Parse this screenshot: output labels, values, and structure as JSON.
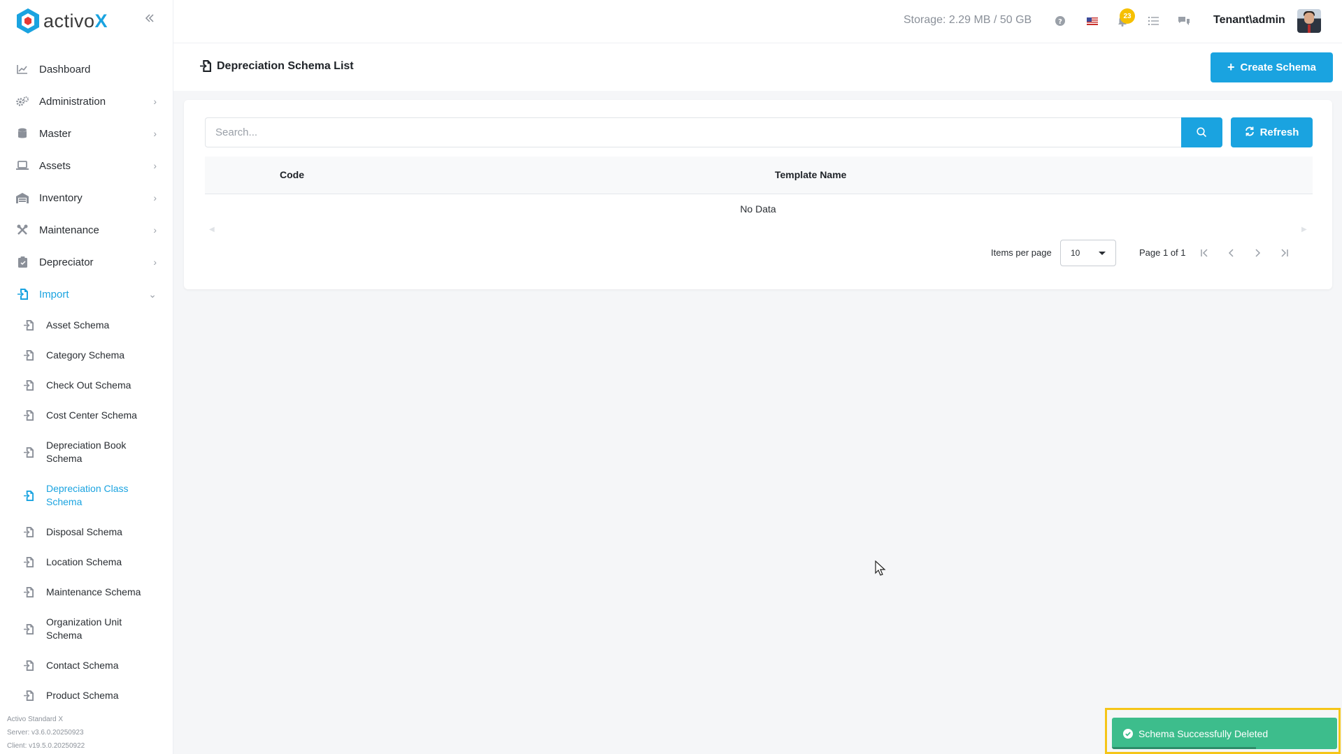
{
  "brand": {
    "name_prefix": "activo",
    "name_suffix": "X",
    "accent": "#1aa3e0"
  },
  "topbar": {
    "storage": "Storage: 2.29 MB / 50 GB",
    "notification_count": "23",
    "user": "Tenant\\admin",
    "icons": [
      "help-icon",
      "flag-us-icon",
      "bell-icon",
      "tasks-icon",
      "chat-icon"
    ]
  },
  "sidebar": {
    "items": [
      {
        "label": "Dashboard",
        "icon": "chart-line-icon"
      },
      {
        "label": "Administration",
        "icon": "cogs-icon"
      },
      {
        "label": "Master",
        "icon": "database-icon"
      },
      {
        "label": "Assets",
        "icon": "laptop-icon"
      },
      {
        "label": "Inventory",
        "icon": "warehouse-icon"
      },
      {
        "label": "Maintenance",
        "icon": "tools-icon"
      },
      {
        "label": "Depreciator",
        "icon": "clipboard-icon"
      },
      {
        "label": "Import",
        "icon": "import-icon"
      }
    ],
    "import_sub": [
      {
        "label": "Asset Schema"
      },
      {
        "label": "Category Schema"
      },
      {
        "label": "Check Out Schema"
      },
      {
        "label": "Cost Center Schema"
      },
      {
        "label": "Depreciation Book Schema"
      },
      {
        "label": "Depreciation Class Schema"
      },
      {
        "label": "Disposal Schema"
      },
      {
        "label": "Location Schema"
      },
      {
        "label": "Maintenance Schema"
      },
      {
        "label": "Organization Unit Schema"
      },
      {
        "label": "Contact Schema"
      },
      {
        "label": "Product Schema"
      }
    ],
    "footer": {
      "edition": "Activo Standard X",
      "server": "Server: v3.6.0.20250923",
      "client": "Client: v19.5.0.20250922"
    }
  },
  "page": {
    "title": "Depreciation Schema List",
    "create_label": "Create Schema"
  },
  "search": {
    "placeholder": "Search..."
  },
  "refresh_label": "Refresh",
  "table": {
    "columns": [
      "Code",
      "Template Name"
    ],
    "empty_text": "No Data"
  },
  "pager": {
    "items_per_page_label": "Items per page",
    "items_per_page": "10",
    "page_info": "Page 1 of 1"
  },
  "toast": {
    "message": "Schema Successfully Deleted",
    "color": "#3dbd8c",
    "progress": 0.64
  }
}
